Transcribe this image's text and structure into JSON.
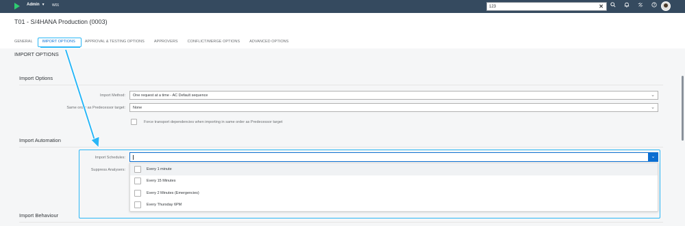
{
  "shell": {
    "user_label": "Admin",
    "system_label": "W01",
    "search_value": "123",
    "icons": [
      "logo-icon",
      "search-icon",
      "bell-icon",
      "transport-icon",
      "help-icon",
      "avatar"
    ],
    "colors": {
      "shell_bg": "#354a5f",
      "accent": "#0a6ed1",
      "highlight": "#29b6f6",
      "logo": "#2ecc71"
    }
  },
  "header": {
    "title": "T01 - S/4HANA Production (0003)",
    "tabs": [
      {
        "label": "GENERAL",
        "active": false
      },
      {
        "label": "IMPORT OPTIONS",
        "active": true
      },
      {
        "label": "APPROVAL & TESTING OPTIONS",
        "active": false
      },
      {
        "label": "APPROVERS",
        "active": false
      },
      {
        "label": "CONFLICT/MERGE OPTIONS",
        "active": false
      },
      {
        "label": "ADVANCED OPTIONS",
        "active": false
      }
    ]
  },
  "content": {
    "section_title": "IMPORT OPTIONS",
    "import_options": {
      "title": "Import Options",
      "method_label": "Import Method:",
      "method_value": "One request at a time - AC Default sequence",
      "same_order_label": "Same order as Predecessor target:",
      "same_order_value": "None",
      "force_label": "Force transport dependencies when importing in same order as Predecessor target"
    },
    "import_automation": {
      "title": "Import Automation",
      "schedules_label": "Import Schedules:",
      "schedules_value": "",
      "suppress_label": "Suppress Analysers:",
      "schedule_options": [
        {
          "label": "Every 1 minute",
          "checked": false
        },
        {
          "label": "Every 15 Minutes",
          "checked": false
        },
        {
          "label": "Every 2 Minutes (Emergencies)",
          "checked": false
        },
        {
          "label": "Every Thursday 6PM",
          "checked": false
        }
      ]
    },
    "import_behaviour": {
      "title": "Import Behaviour"
    }
  }
}
